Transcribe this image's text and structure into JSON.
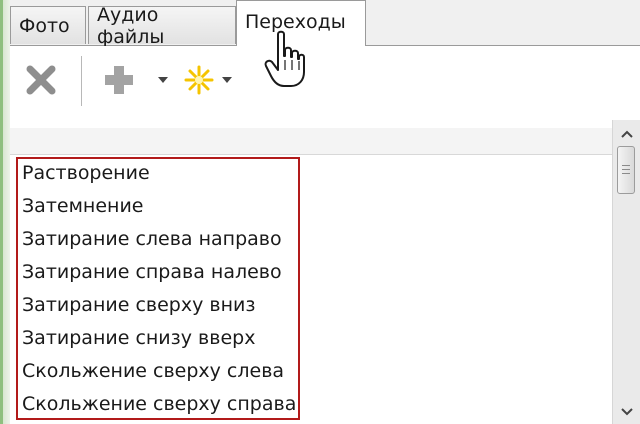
{
  "tabs": [
    {
      "label": "Фото",
      "active": false
    },
    {
      "label": "Аудио файлы",
      "active": false
    },
    {
      "label": "Переходы",
      "active": true
    }
  ],
  "toolbar": {
    "delete_icon": "delete-x-icon",
    "add_icon": "plus-icon",
    "effect_icon": "sparkle-icon"
  },
  "transitions": [
    "Растворение",
    "Затемнение",
    "Затирание слева направо",
    "Затирание справа налево",
    "Затирание сверху вниз",
    "Затирание снизу вверх",
    "Скольжение сверху слева",
    "Скольжение сверху справа"
  ],
  "colors": {
    "highlight": "#b21a1a",
    "effect_icon": "#f5c400",
    "disabled_icon": "#9a9a9a"
  }
}
